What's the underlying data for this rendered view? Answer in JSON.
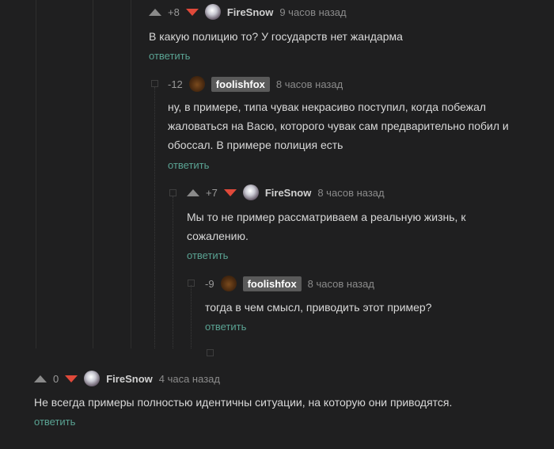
{
  "reply_label": "ответить",
  "comments": [
    {
      "score": "+8",
      "user": "FireSnow",
      "time": "9 часов назад",
      "lines": [
        "В какую полицию то? У государств нет жандарма"
      ]
    },
    {
      "score": "-12",
      "user": "foolishfox",
      "time": "8 часов назад",
      "lines": [
        "ну, в примере, типа чувак некрасиво поступил, когда побежал",
        "жаловаться на Васю, которого чувак сам предварительно побил и",
        "обоссал. В примере полиция есть"
      ]
    },
    {
      "score": "+7",
      "user": "FireSnow",
      "time": "8 часов назад",
      "lines": [
        "Мы то не пример рассматриваем а реальную жизнь, к",
        "сожалению."
      ]
    },
    {
      "score": "-9",
      "user": "foolishfox",
      "time": "8 часов назад",
      "lines": [
        "тогда в чем смысл, приводить этот пример?"
      ]
    },
    {
      "score": "0",
      "user": "FireSnow",
      "time": "4 часа назад",
      "lines": [
        "Не всегда примеры полностью идентичны ситуации, на которую они приводятся."
      ]
    }
  ],
  "colors": {
    "upvote": "#8a8a8a",
    "downvote": "#e0493a",
    "reply": "#5aa393",
    "background": "#1f1f20"
  },
  "icons": {
    "upvote": "triangle-up-icon",
    "downvote": "triangle-down-icon"
  }
}
